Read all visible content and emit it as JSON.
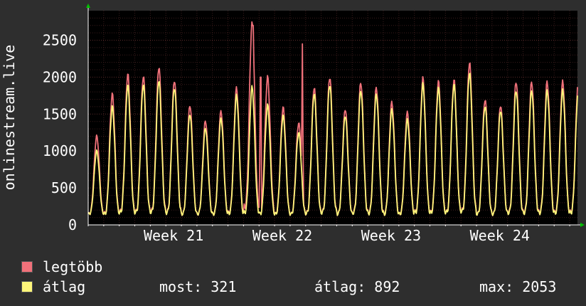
{
  "colors": {
    "background": "#2e2e2e",
    "plot_background": "#000000",
    "grid_major": "#5a2a2a",
    "grid_minor": "#3a1c1c",
    "axis": "#ffffff",
    "max_series": "#f0717a",
    "avg_series": "#fff67a",
    "axis_arrow": "#00c000"
  },
  "chart_data": {
    "type": "line",
    "title": "",
    "ylabel": "onlinestream.live",
    "xlabel": "",
    "ylim": [
      0,
      2900
    ],
    "yticks": [
      "0",
      "500",
      "1000",
      "1500",
      "2000",
      "2500"
    ],
    "x_range_days": [
      0,
      31.5
    ],
    "xtick_labels": [
      {
        "label": "Week 21",
        "day": 5.5
      },
      {
        "label": "Week 22",
        "day": 12.5
      },
      {
        "label": "Week 23",
        "day": 19.5
      },
      {
        "label": "Week 24",
        "day": 26.5
      }
    ],
    "grid": true,
    "series": [
      {
        "name": "legtöbb",
        "color": "#f0717a",
        "daily_peaks": [
          1200,
          1770,
          2040,
          2010,
          2140,
          1960,
          1620,
          1410,
          1540,
          1850,
          2710,
          2000,
          1590,
          1380,
          1860,
          2000,
          1570,
          1930,
          1860,
          1660,
          1520,
          1980,
          1940,
          1960,
          2200,
          1700,
          1620,
          1940
        ],
        "spikes": [
          {
            "day": 10.6,
            "value": 2700
          },
          {
            "day": 11.1,
            "value": 2000
          },
          {
            "day": 13.8,
            "value": 2450
          }
        ]
      },
      {
        "name": "átlag",
        "color": "#fff67a",
        "daily_peaks": [
          1000,
          1600,
          1890,
          1900,
          1960,
          1860,
          1500,
          1310,
          1440,
          1750,
          1860,
          1620,
          1480,
          1250,
          1780,
          1900,
          1480,
          1820,
          1770,
          1560,
          1420,
          1900,
          1850,
          1900,
          2060,
          1610,
          1550,
          1820
        ],
        "spikes": []
      }
    ]
  },
  "legend": {
    "items": [
      {
        "label": "legtöbb",
        "color": "#f0717a"
      },
      {
        "label": "átlag",
        "color": "#fff67a"
      }
    ],
    "stats": {
      "now": "most: 321",
      "avg": "átlag: 892",
      "max": "max: 2053"
    }
  }
}
